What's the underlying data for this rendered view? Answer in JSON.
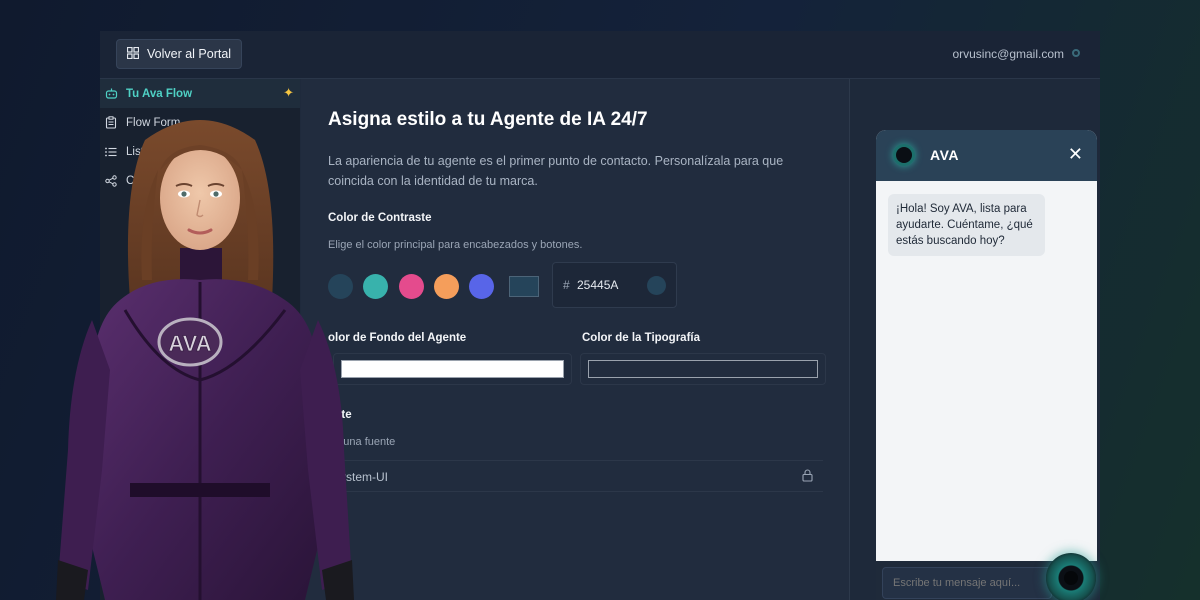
{
  "topbar": {
    "back_label": "Volver al Portal",
    "user_email": "orvusinc@gmail.com"
  },
  "sidebar": {
    "items": [
      {
        "label": "Tu Ava Flow",
        "icon": "bot-icon",
        "active": true
      },
      {
        "label": "Flow Form",
        "icon": "clipboard-icon"
      },
      {
        "label": "Listas",
        "icon": "list-icon"
      },
      {
        "label": "Con",
        "icon": "share-icon"
      }
    ]
  },
  "main": {
    "title": "Asigna estilo a tu Agente de IA 24/7",
    "description": "La apariencia de tu agente es el primer punto de contacto. Personalízala para que coincida con la identidad de tu marca.",
    "contrast": {
      "title": "Color de Contraste",
      "subtitle": "Elige el color principal para encabezados y botones.",
      "swatches": [
        "#25445A",
        "#38B2AC",
        "#E44B8D",
        "#F59E5B",
        "#5865E8"
      ],
      "hex_prefix": "#",
      "hex_value": "25445A"
    },
    "background_color": {
      "title": "olor de Fondo del Agente",
      "value": "#FFFFFF"
    },
    "typography_color": {
      "title": "Color de la Tipografía"
    },
    "font": {
      "title": "ente",
      "subtitle": "gir una fuente",
      "value": "ystem-UI"
    }
  },
  "chat": {
    "agent_name": "AVA",
    "welcome_message": "¡Hola! Soy AVA, lista para ayudarte. Cuéntame, ¿qué estás buscando hoy?",
    "input_placeholder": "Escribe tu mensaje aquí..."
  },
  "illustration": {
    "badge_text": "AVA"
  }
}
